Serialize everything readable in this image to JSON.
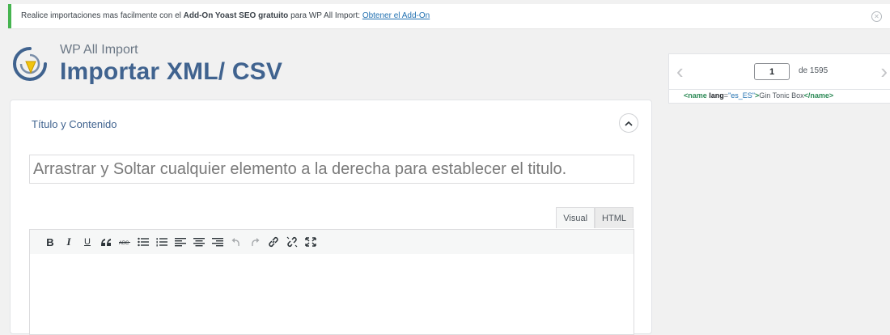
{
  "notice": {
    "text_before": "Realice importaciones mas facilmente con el ",
    "bold": "Add-On Yoast SEO gratuito",
    "text_after": " para WP All Import: ",
    "link": "Obtener el Add-On",
    "accent_color": "#46b450"
  },
  "header": {
    "subtitle": "WP All Import",
    "title": "Importar XML/ CSV"
  },
  "pager": {
    "current": "1",
    "of_label": "de 1595"
  },
  "xml_preview": {
    "open_tag": "<name",
    "attr_name": " lang",
    "eq": "=",
    "attr_value": "\"es_ES\"",
    "close_bracket": ">",
    "content": "Gin Tonic Box",
    "end_tag": "</name>"
  },
  "panel": {
    "title": "Título y Contenido",
    "title_placeholder": "Arrastrar y Soltar cualquier elemento a la derecha para establecer el titulo.",
    "tabs": [
      "Visual",
      "HTML"
    ],
    "toolbar": {
      "bold": "B",
      "italic": "I",
      "underline": "U"
    }
  }
}
